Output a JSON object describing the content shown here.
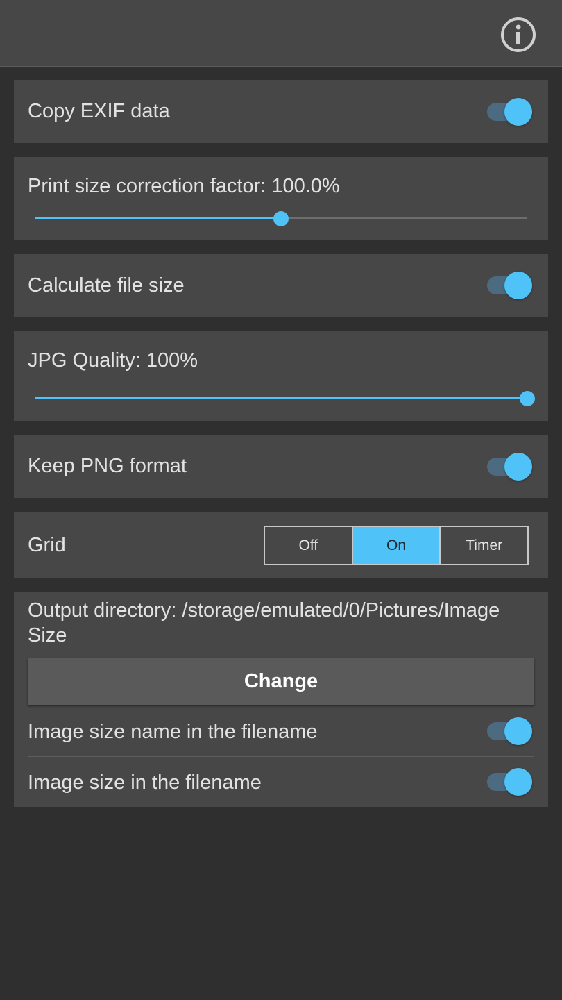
{
  "header": {
    "info_icon": "info-circle-icon"
  },
  "settings": {
    "copy_exif": {
      "label": "Copy EXIF data",
      "enabled": true
    },
    "print_size": {
      "label": "Print size correction factor: 100.0%",
      "position": 0.5
    },
    "calculate_file_size": {
      "label": "Calculate file size",
      "enabled": true
    },
    "jpg_quality": {
      "label": "JPG Quality: 100%",
      "value_percent": 100
    },
    "keep_png": {
      "label": "Keep PNG format",
      "enabled": true
    },
    "grid": {
      "label": "Grid",
      "options": [
        "Off",
        "On",
        "Timer"
      ],
      "selected": "On"
    },
    "output": {
      "label": "Output directory: /storage/emulated/0/Pictures/Image Size",
      "change_label": "Change",
      "size_name_in_filename": {
        "label": "Image size name in the filename",
        "enabled": true
      },
      "size_in_filename": {
        "label": "Image size in the filename",
        "enabled": true
      }
    }
  },
  "colors": {
    "accent": "#4fc3f7",
    "card": "#474747",
    "background": "#2f2f2f"
  }
}
